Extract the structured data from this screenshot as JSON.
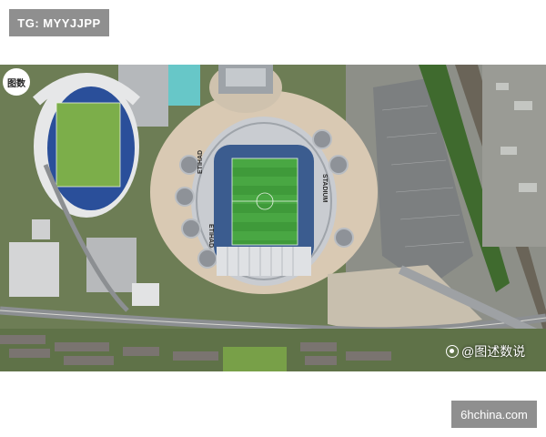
{
  "top_tag": "TG: MYYJJPP",
  "logo": "图数",
  "watermark": "@图述数说",
  "bottom_tag": "6hchina.com",
  "stadium_text": {
    "south_stand": "ETIHAD",
    "west_stand": "ETIHAD",
    "east_stand": "STADIUM"
  },
  "colors": {
    "tag_bg": "#8f8f8f",
    "pitch": "#3f9a3a",
    "track": "#2a4f9a",
    "plaza": "#d9c9b3",
    "roof": "#c9ccd1"
  }
}
